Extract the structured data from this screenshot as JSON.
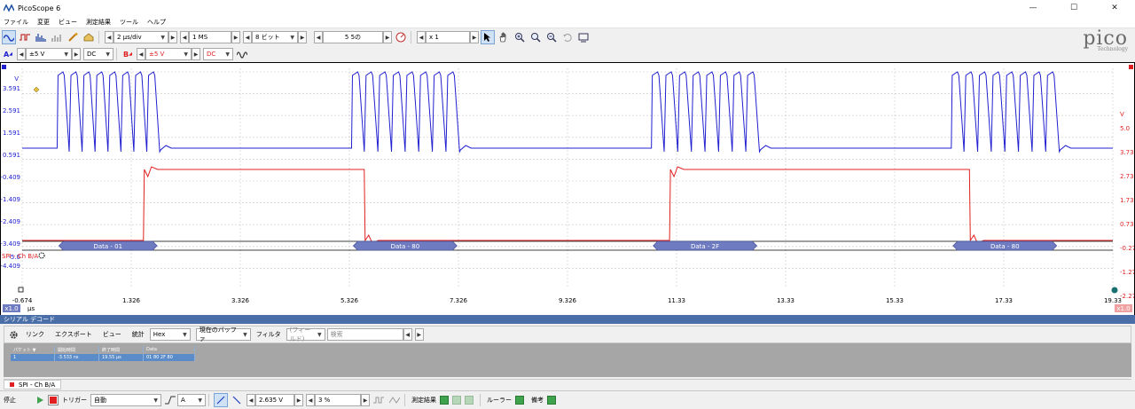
{
  "window": {
    "title": "PicoScope 6",
    "minimize": "—",
    "maximize": "☐",
    "close": "✕"
  },
  "menu": [
    "ファイル",
    "変更",
    "ビュー",
    "測定結果",
    "ツール",
    "ヘルプ"
  ],
  "toolbar1": {
    "timebase": "2 µs/div",
    "samples": "1 MS",
    "resolution": "8 ビット",
    "captures": "5 5の",
    "zoom": "x 1"
  },
  "toolbar2": {
    "channel_a": "A",
    "range_a": "±5 V",
    "coupling_a": "DC",
    "channel_b": "B",
    "range_b": "±5 V",
    "coupling_b": "DC"
  },
  "logo": {
    "text": "pico",
    "sub": "Technology"
  },
  "scope": {
    "left_axis_unit": "V",
    "left_ticks": [
      "3.591",
      "2.591",
      "1.591",
      "0.591",
      "-0.409",
      "-1.409",
      "-2.409",
      "-3.409",
      "-4.409",
      "-5.0"
    ],
    "right_axis_unit": "V",
    "right_ticks": [
      "5.0",
      "3.73",
      "2.73",
      "1.73",
      "0.73",
      "-0.27",
      "-1.27",
      "-2.27"
    ],
    "x_ticks": [
      "-0.674",
      "1.326",
      "3.326",
      "5.326",
      "7.326",
      "9.326",
      "11.33",
      "13.33",
      "15.33",
      "17.33",
      "19.33"
    ],
    "x_unit": "µs",
    "left_scale_badge": "x1.0",
    "right_scale_badge": "x1.0",
    "bus_label": "SPI - Ch B/A",
    "packets": [
      {
        "label": "Data - 01",
        "start_us": 0.0,
        "end_us": 1.8
      },
      {
        "label": "Data - 80",
        "start_us": 5.4,
        "end_us": 7.3
      },
      {
        "label": "Data - 2F",
        "start_us": 10.9,
        "end_us": 12.8
      },
      {
        "label": "Data - 80",
        "start_us": 16.4,
        "end_us": 18.3
      }
    ],
    "colors": {
      "channel_a": "#2020d0",
      "channel_b": "#e02020",
      "packet": "#6f7bc0"
    }
  },
  "serial_decode": {
    "title": "シリアル デコード",
    "tools": {
      "link": "リンク",
      "export": "エクスポート",
      "view": "ビュー",
      "stats": "統計",
      "format": "Hex",
      "buffer": "現在のバッファ",
      "filter": "フィルタ",
      "field": "(フィールド)",
      "search": "検索"
    },
    "columns": [
      "パケット ▼",
      "開始時間",
      "終了時間",
      "Data"
    ],
    "rows": [
      {
        "packet": "1",
        "start": "-3.533 ns",
        "end": "19.55 µs",
        "data": "01 80 2F 80"
      }
    ],
    "tab": "SPI - Ch B/A"
  },
  "status": {
    "stop": "停止",
    "trigger": "トリガー",
    "trigger_mode": "自動",
    "trigger_source": "A",
    "trigger_level": "2.635 V",
    "pretrigger": "3 %",
    "measurements": "測定結果",
    "rulers": "ルーラー",
    "notes": "備考"
  }
}
